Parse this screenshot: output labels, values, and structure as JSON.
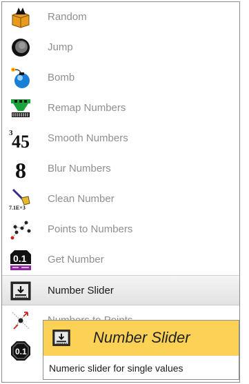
{
  "menu": {
    "items": [
      {
        "label": "Random",
        "icon": "dice-box-icon"
      },
      {
        "label": "Jump",
        "icon": "jump-circle-icon"
      },
      {
        "label": "Bomb",
        "icon": "bomb-icon"
      },
      {
        "label": "Remap Numbers",
        "icon": "remap-numbers-icon"
      },
      {
        "label": "Smooth Numbers",
        "icon": "smooth-numbers-icon"
      },
      {
        "label": "Blur Numbers",
        "icon": "blur-numbers-icon"
      },
      {
        "label": "Clean Number",
        "icon": "clean-number-icon"
      },
      {
        "label": "Points to Numbers",
        "icon": "points-to-numbers-icon"
      },
      {
        "label": "Get Number",
        "icon": "get-number-icon"
      },
      {
        "label": "Number Slider",
        "icon": "number-slider-icon"
      },
      {
        "label": "Numbers to Points",
        "icon": "numbers-to-points-icon"
      }
    ],
    "active_index": 9,
    "icon_glyphs": {
      "smooth": "45",
      "smooth_small": "3",
      "blur": "8",
      "clean": "7.1E+3",
      "get": "0.1",
      "last": "0.1"
    }
  },
  "tooltip": {
    "title": "Number Slider",
    "description": "Numeric slider for single values",
    "icon": "number-slider-icon"
  },
  "colors": {
    "tooltip_header": "#fbd256",
    "label_muted": "#8f8f8f",
    "label_active": "#1a1a1a"
  }
}
